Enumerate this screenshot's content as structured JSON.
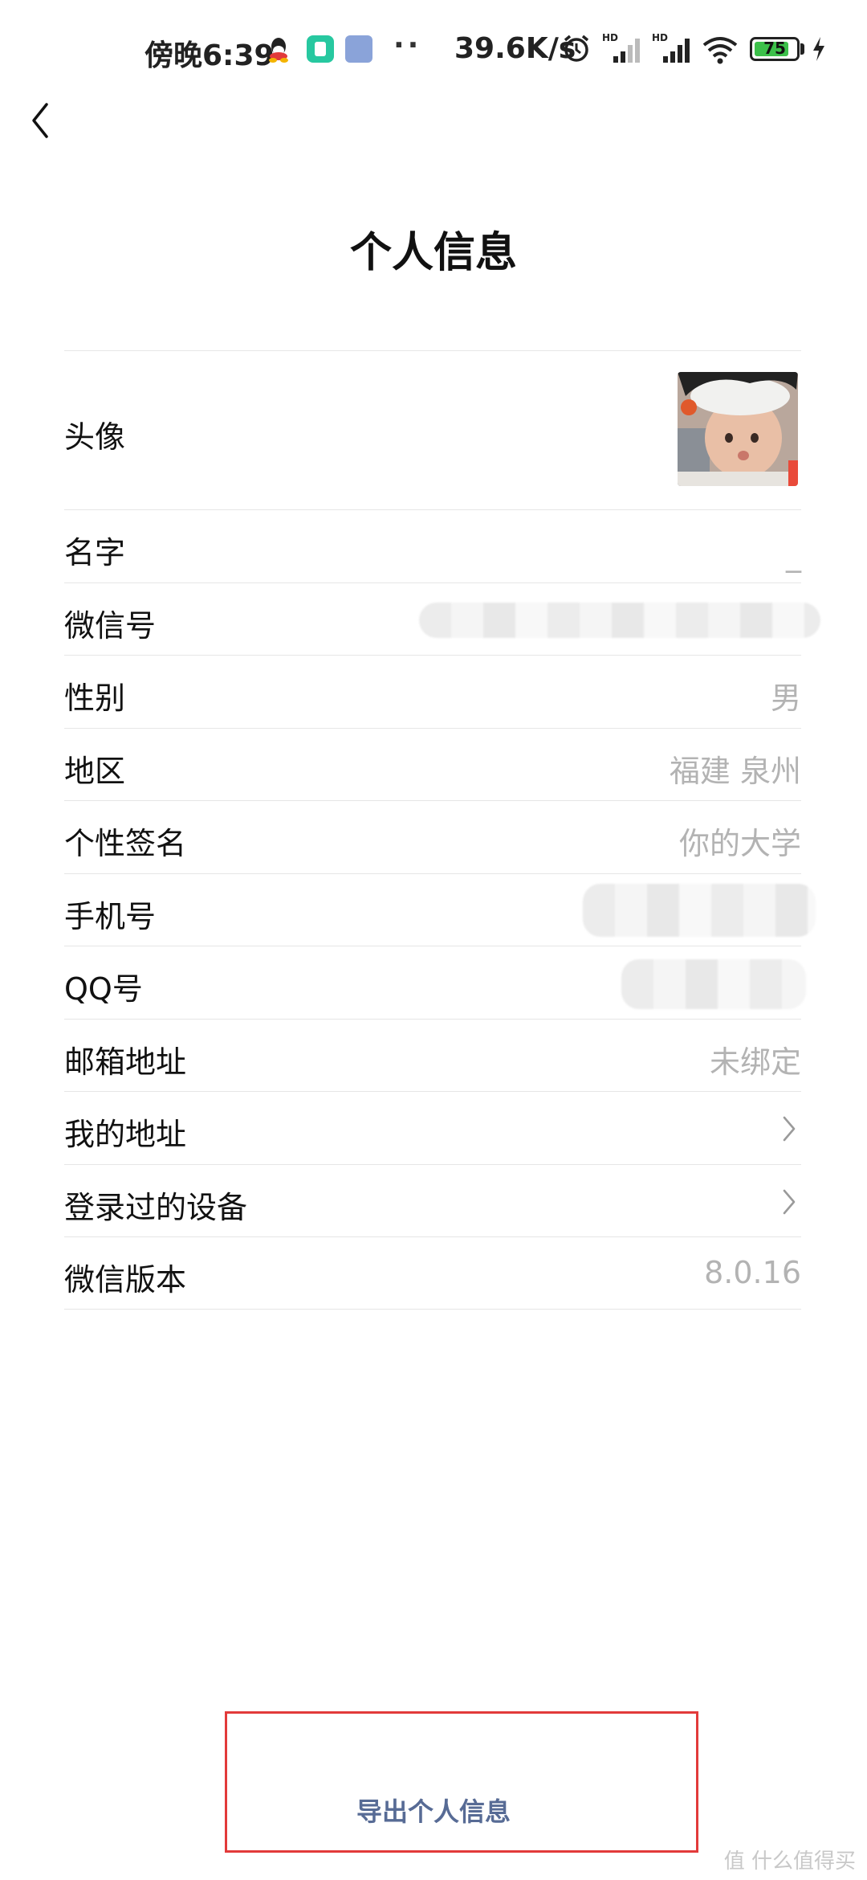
{
  "status_bar": {
    "time": "傍晚6:39",
    "dots": "··",
    "network_speed": "39.6K/s",
    "battery": "75",
    "icons": [
      "qq-icon",
      "app-shield-icon",
      "app-book-icon",
      "alarm-icon",
      "signal-hd-icon",
      "signal-hd-icon",
      "wifi-icon",
      "battery-icon",
      "charging-icon"
    ]
  },
  "header": {
    "title": "个人信息",
    "back_icon": "chevron-left-icon"
  },
  "rows": [
    {
      "label": "头像",
      "type": "avatar"
    },
    {
      "label": "名字",
      "value": "_"
    },
    {
      "label": "微信号",
      "value": "",
      "type": "blurred"
    },
    {
      "label": "性别",
      "value": "男"
    },
    {
      "label": "地区",
      "value": "福建 泉州"
    },
    {
      "label": "个性签名",
      "value": "你的大学"
    },
    {
      "label": "手机号",
      "value": "",
      "type": "blurred"
    },
    {
      "label": "QQ号",
      "value": "",
      "type": "blurred"
    },
    {
      "label": "邮箱地址",
      "value": "未绑定"
    },
    {
      "label": "我的地址",
      "type": "chevron"
    },
    {
      "label": "登录过的设备",
      "type": "chevron"
    },
    {
      "label": "微信版本",
      "value": "8.0.16"
    }
  ],
  "export": {
    "label": "导出个人信息"
  },
  "watermark": "值 什么值得买",
  "colors": {
    "link": "#576b95",
    "highlight_box": "#e23a3a",
    "value_gray": "#b3b3b3",
    "battery_green": "#3cc04a"
  }
}
